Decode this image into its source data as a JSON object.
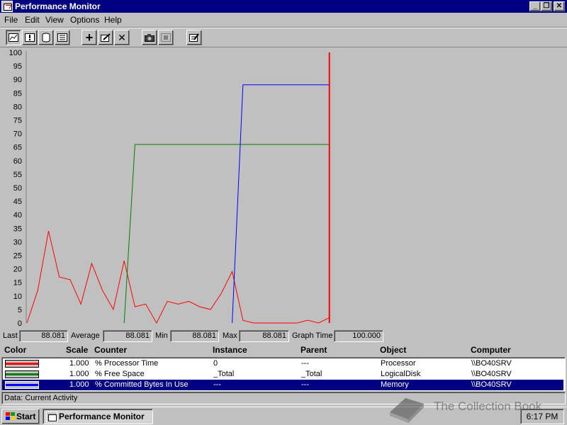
{
  "window": {
    "title": "Performance Monitor",
    "controls": {
      "minimize": "_",
      "maximize": "❐",
      "close": "✕"
    }
  },
  "menu": [
    "File",
    "Edit",
    "View",
    "Options",
    "Help"
  ],
  "toolbar": {
    "buttons": [
      {
        "icon": "chart-view-icon"
      },
      {
        "icon": "alert-view-icon"
      },
      {
        "icon": "log-view-icon"
      },
      {
        "icon": "report-view-icon"
      },
      {
        "icon": "add-counter-icon",
        "glyph": "+"
      },
      {
        "icon": "edit-counter-icon"
      },
      {
        "icon": "delete-counter-icon",
        "glyph": "✕"
      },
      {
        "icon": "update-now-icon"
      },
      {
        "icon": "place-bookmark-icon"
      },
      {
        "icon": "options-icon"
      }
    ]
  },
  "chart_data": {
    "type": "line",
    "ylim": [
      0,
      100
    ],
    "yticks": [
      "100",
      "95",
      "90",
      "85",
      "80",
      "75",
      "70",
      "65",
      "60",
      "55",
      "50",
      "45",
      "40",
      "35",
      "30",
      "25",
      "20",
      "15",
      "10",
      "5",
      "0"
    ],
    "x_samples": 100,
    "current_index": 28,
    "grid": false,
    "series": [
      {
        "counter": "% Processor Time",
        "color": "#ff0000",
        "x": [
          0,
          1,
          2,
          3,
          4,
          5,
          6,
          7,
          8,
          9,
          10,
          11,
          12,
          13,
          14,
          15,
          16,
          17,
          18,
          19,
          20,
          21,
          22,
          23,
          24,
          25,
          26,
          27,
          28
        ],
        "values": [
          0,
          12,
          34,
          17,
          16,
          7,
          22,
          12,
          5,
          23,
          6,
          7,
          0,
          8,
          7,
          8,
          6,
          5,
          11,
          19,
          1,
          0,
          0,
          0,
          0,
          0,
          1,
          0,
          2
        ]
      },
      {
        "counter": "% Free Space",
        "color": "#008000",
        "x": [
          9,
          10,
          28
        ],
        "values": [
          0,
          66,
          66
        ]
      },
      {
        "counter": "% Committed Bytes In Use",
        "color": "#0000ff",
        "x": [
          19,
          20,
          28
        ],
        "values": [
          0,
          88,
          88
        ]
      }
    ]
  },
  "stats": {
    "last_label": "Last",
    "last": "88.081",
    "average_label": "Average",
    "average": "88.081",
    "min_label": "Min",
    "min": "88.081",
    "max_label": "Max",
    "max": "88.081",
    "graph_time_label": "Graph Time",
    "graph_time": "100.000"
  },
  "legend": {
    "headers": {
      "color": "Color",
      "scale": "Scale",
      "counter": "Counter",
      "instance": "Instance",
      "parent": "Parent",
      "object": "Object",
      "computer": "Computer"
    },
    "rows": [
      {
        "color": "#ff0000",
        "scale": "1.000",
        "counter": "% Processor Time",
        "instance": "0",
        "parent": "---",
        "object": "Processor",
        "computer": "\\\\BO40SRV",
        "selected": false
      },
      {
        "color": "#008000",
        "scale": "1.000",
        "counter": "% Free Space",
        "instance": "_Total",
        "parent": "_Total",
        "object": "LogicalDisk",
        "computer": "\\\\BO40SRV",
        "selected": false
      },
      {
        "color": "#0000ff",
        "scale": "1.000",
        "counter": "% Committed Bytes In Use",
        "instance": "---",
        "parent": "---",
        "object": "Memory",
        "computer": "\\\\BO40SRV",
        "selected": true
      }
    ]
  },
  "status": "Data: Current Activity",
  "taskbar": {
    "start": "Start",
    "task": "Performance Monitor",
    "clock": "6:17 PM"
  },
  "watermark": "The Collection Book",
  "colors": {
    "titlebar": "#000080",
    "face": "#c0c0c0",
    "selection": "#000080"
  }
}
